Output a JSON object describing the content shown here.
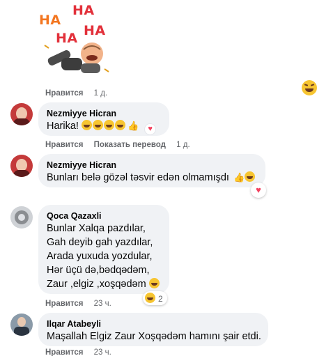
{
  "sticker": {
    "text": [
      "HA",
      "HA",
      "HA",
      "HA"
    ]
  },
  "comments": [
    {
      "actions": {
        "like": "Нравится",
        "time": "1 д."
      },
      "reaction_icon": "laughing-emoji-icon"
    },
    {
      "author": "Nezmiyye Hicran",
      "text": "Harika!",
      "actions": {
        "like": "Нравится",
        "translate": "Показать перевод",
        "time": "1 д."
      },
      "reaction_icon": "heart-icon"
    },
    {
      "author": "Nezmiyye Hicran",
      "text": "Bunları belə gözəl təsvir edən olmamışdı",
      "reaction_icon": "heart-icon"
    },
    {
      "author": "Qoca Qazaxli",
      "lines": [
        "Bunlar Xalqa pazdılar,",
        "Gah deyib gah yazdılar,",
        "Arada yuxuda yozdular,",
        "Hər üçü də,bədqədəm,",
        "Zaur ,elgiz ,xoşqədəm"
      ],
      "actions": {
        "like": "Нравится",
        "time": "23 ч."
      },
      "reaction_count": "2"
    },
    {
      "author": "Ilqar Atabeyli",
      "text": "Maşallah Elgiz Zaur Xoşqədəm hamını şair etdi.",
      "actions": {
        "like": "Нравится",
        "time": "23 ч."
      }
    }
  ],
  "colors": {
    "bubble": "#f0f2f5",
    "meta": "#65676b",
    "heart": "#f3425f",
    "emoji": "#f7c531"
  }
}
